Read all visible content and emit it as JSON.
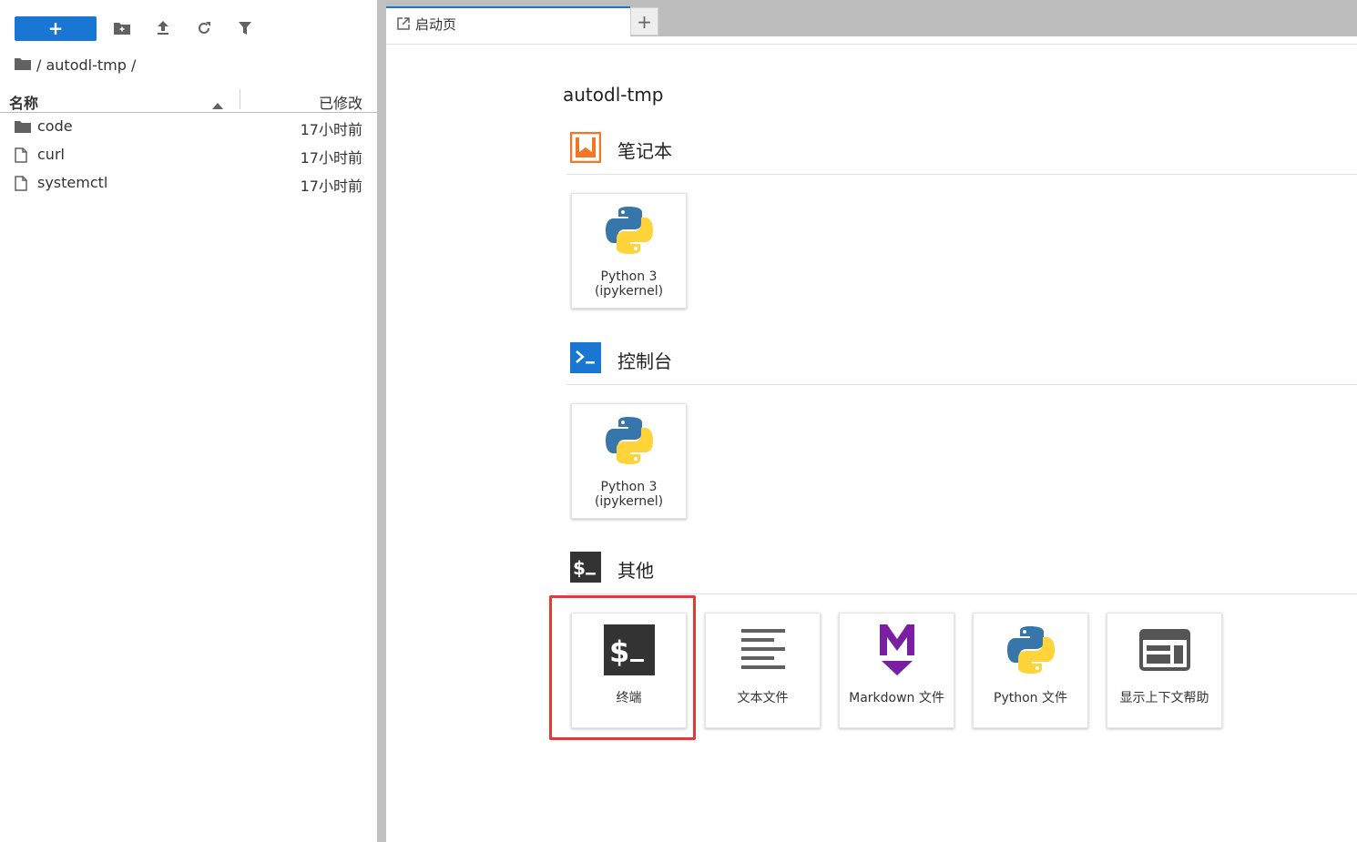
{
  "sidebar": {
    "new_button_label": "+",
    "toolbar_icons": [
      "new-folder-icon",
      "upload-icon",
      "refresh-icon",
      "filter-icon"
    ],
    "breadcrumb": "/ autodl-tmp /",
    "columns": {
      "name": "名称",
      "modified": "已修改"
    },
    "files": [
      {
        "name": "code",
        "type": "folder",
        "modified": "17小时前"
      },
      {
        "name": "curl",
        "type": "file",
        "modified": "17小时前"
      },
      {
        "name": "systemctl",
        "type": "file",
        "modified": "17小时前"
      }
    ]
  },
  "tabs": [
    {
      "label": "启动页",
      "icon": "launcher-icon"
    }
  ],
  "add_tab_label": "+",
  "launcher": {
    "cwd": "autodl-tmp",
    "sections": {
      "notebook": {
        "title": "笔记本",
        "cards": [
          {
            "line1": "Python 3",
            "line2": "(ipykernel)"
          }
        ]
      },
      "console": {
        "title": "控制台",
        "cards": [
          {
            "line1": "Python 3",
            "line2": "(ipykernel)"
          }
        ]
      },
      "other": {
        "title": "其他",
        "cards": [
          {
            "label": "终端",
            "icon": "terminal-icon"
          },
          {
            "label": "文本文件",
            "icon": "text-file-icon"
          },
          {
            "label": "Markdown 文件",
            "icon": "markdown-icon"
          },
          {
            "label": "Python 文件",
            "icon": "python-icon"
          },
          {
            "label": "显示上下文帮助",
            "icon": "context-help-icon"
          }
        ]
      }
    }
  },
  "colors": {
    "accent": "#1976d2",
    "highlight": "#e53935",
    "notebook_orange": "#f37626",
    "markdown_purple": "#7b1fa2"
  }
}
